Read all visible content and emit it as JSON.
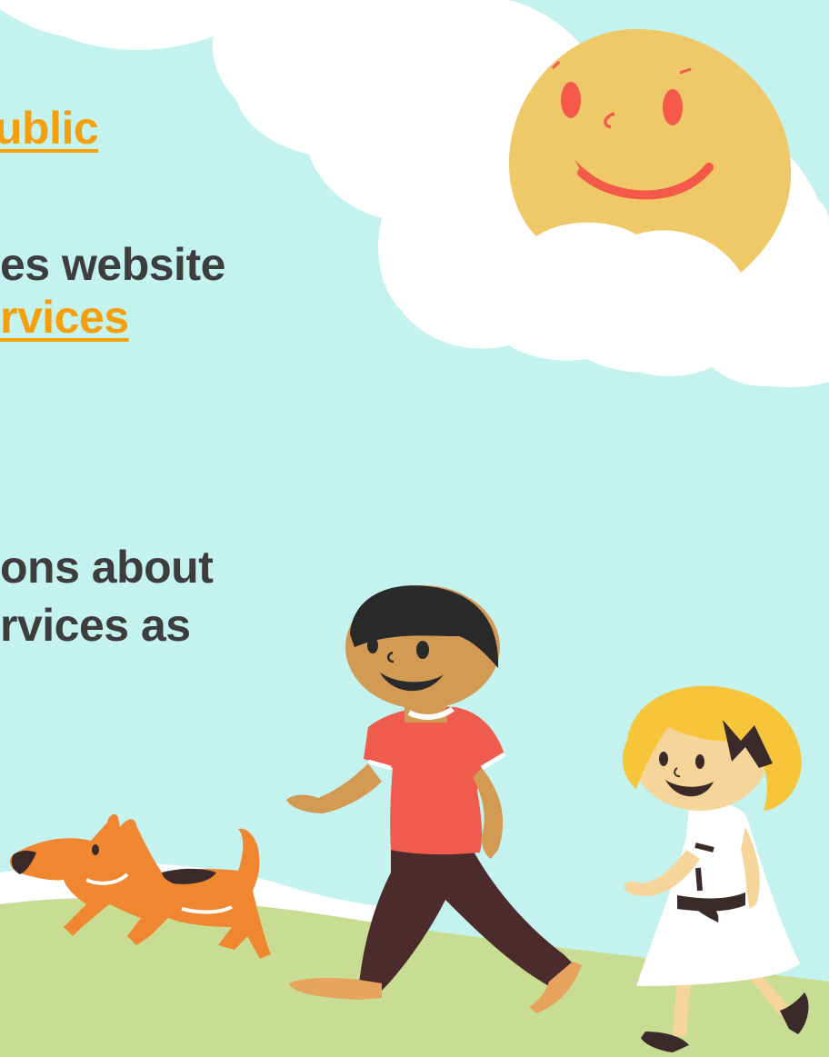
{
  "slide": {
    "lines": [
      {
        "text": "ublic",
        "kind": "link"
      },
      {
        "text": "es website",
        "kind": "text"
      },
      {
        "text": "rvices",
        "kind": "link"
      },
      {
        "text": "ons about",
        "kind": "text"
      },
      {
        "text": "rvices as",
        "kind": "text"
      }
    ]
  },
  "illustration": {
    "characters": [
      "sun-smiling",
      "cloud",
      "dog",
      "boy",
      "girl",
      "grass-hill"
    ]
  },
  "colors": {
    "sky": "#c3f2ef",
    "cloud": "#ffffff",
    "sun": "#efc867",
    "sun_face": "#f4594a",
    "grass": "#c8dd93",
    "text": "#3d3d3d",
    "link": "#f5a00b",
    "dog": "#f0862f",
    "shirt": "#ef5b4d",
    "pants": "#4b2b2b",
    "skin": "#d29a52",
    "hair_boy": "#2a2a2a",
    "hair_girl": "#f6c53a",
    "dress": "#ffffff"
  }
}
